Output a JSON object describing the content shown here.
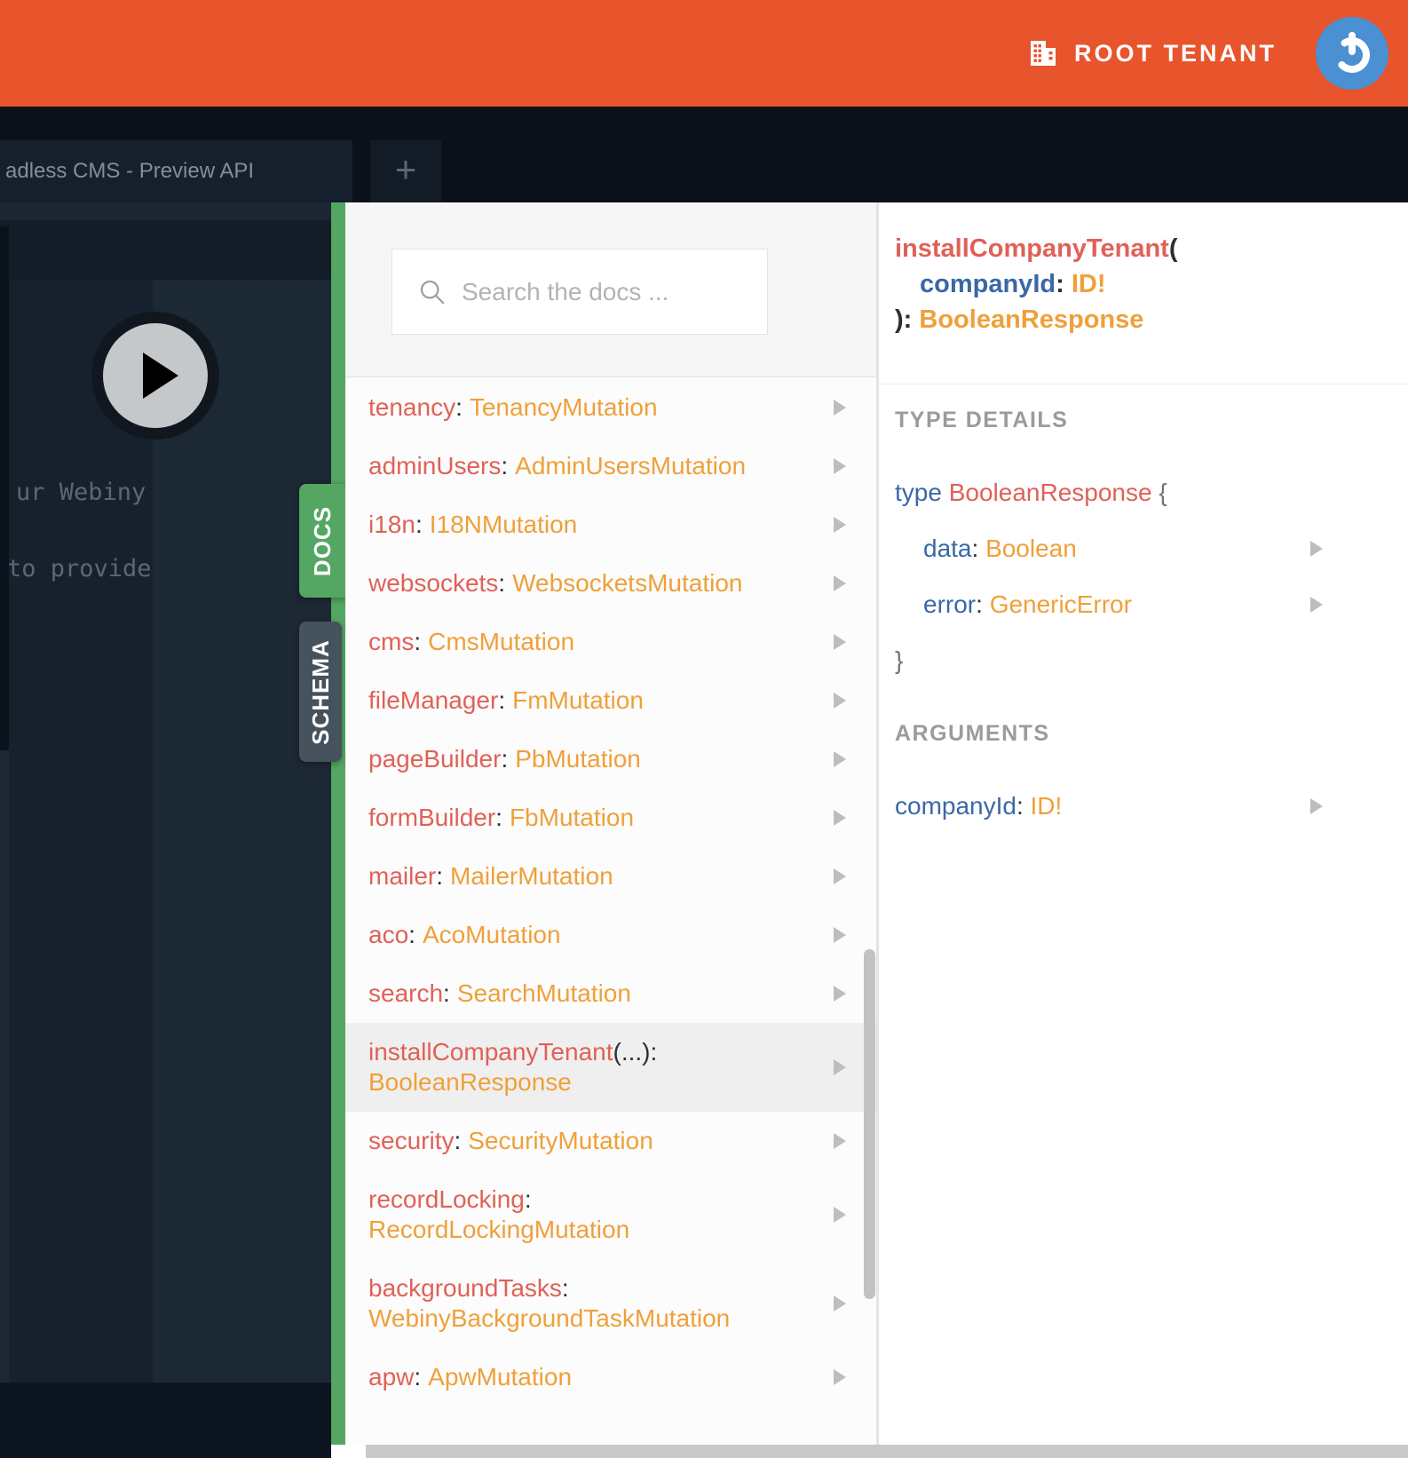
{
  "header": {
    "tenant_label": "ROOT TENANT"
  },
  "tab_bar": {
    "active_tab_title": "adless CMS - Preview API",
    "new_tab_label": "+"
  },
  "editor": {
    "code_lines": [
      "ur Webiny",
      "to provide"
    ]
  },
  "side_tabs": {
    "docs_label": "DOCS",
    "schema_label": "SCHEMA"
  },
  "docs_panel": {
    "search_placeholder": "Search the docs ...",
    "fields": [
      {
        "name": "tenancy",
        "type": "TenancyMutation"
      },
      {
        "name": "adminUsers",
        "type": "AdminUsersMutation"
      },
      {
        "name": "i18n",
        "type": "I18NMutation"
      },
      {
        "name": "websockets",
        "type": "WebsocketsMutation"
      },
      {
        "name": "cms",
        "type": "CmsMutation"
      },
      {
        "name": "fileManager",
        "type": "FmMutation"
      },
      {
        "name": "pageBuilder",
        "type": "PbMutation"
      },
      {
        "name": "formBuilder",
        "type": "FbMutation"
      },
      {
        "name": "mailer",
        "type": "MailerMutation"
      },
      {
        "name": "aco",
        "type": "AcoMutation"
      },
      {
        "name": "search",
        "type": "SearchMutation"
      },
      {
        "name": "installCompanyTenant",
        "args": "(...)",
        "type": "BooleanResponse",
        "wrap": true,
        "selected": true
      },
      {
        "name": "security",
        "type": "SecurityMutation"
      },
      {
        "name": "recordLocking",
        "type": "RecordLockingMutation",
        "wrap": true
      },
      {
        "name": "backgroundTasks",
        "type": "WebinyBackgroundTaskMutation",
        "wrap": true
      },
      {
        "name": "apw",
        "type": "ApwMutation"
      }
    ]
  },
  "detail_panel": {
    "signature": {
      "name": "installCompanyTenant",
      "open_paren": "(",
      "arg_name": "companyId",
      "arg_colon": ":",
      "arg_type": "ID!",
      "close_paren": "):",
      "return_type": "BooleanResponse"
    },
    "type_details": {
      "heading": "TYPE DETAILS",
      "keyword": "type",
      "type_name": "BooleanResponse",
      "open_brace": "{",
      "fields": [
        {
          "name": "data",
          "type": "Boolean"
        },
        {
          "name": "error",
          "type": "GenericError"
        }
      ],
      "close_brace": "}"
    },
    "arguments": {
      "heading": "ARGUMENTS",
      "args": [
        {
          "name": "companyId",
          "type": "ID!"
        }
      ]
    }
  },
  "colors": {
    "header_orange": "#E8542C",
    "avatar_blue": "#4A90D3",
    "docs_green": "#54A763",
    "schema_slate": "#46525E",
    "field_red": "#E06157",
    "type_orange": "#EFA03A",
    "field_blue": "#3A68A7"
  }
}
